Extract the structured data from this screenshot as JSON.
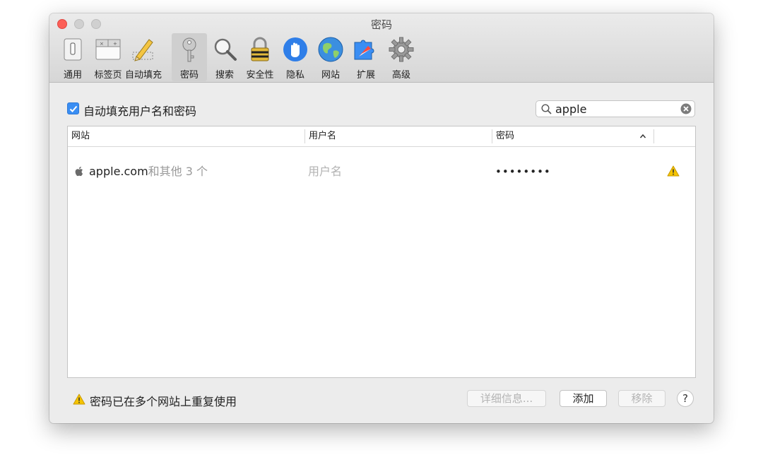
{
  "window": {
    "title": "密码"
  },
  "toolbar": {
    "items": [
      {
        "label": "通用",
        "icon": "general-switch-icon"
      },
      {
        "label": "标签页",
        "icon": "tabs-icon"
      },
      {
        "label": "自动填充",
        "icon": "pencil-icon"
      },
      {
        "label": "密码",
        "icon": "key-icon",
        "active": true
      },
      {
        "label": "搜索",
        "icon": "magnifier-icon"
      },
      {
        "label": "安全性",
        "icon": "lock-icon"
      },
      {
        "label": "隐私",
        "icon": "hand-icon"
      },
      {
        "label": "网站",
        "icon": "globe-icon"
      },
      {
        "label": "扩展",
        "icon": "puzzle-compass-icon"
      },
      {
        "label": "高级",
        "icon": "gear-icon"
      }
    ]
  },
  "autofill": {
    "label": "自动填充用户名和密码",
    "checked": true
  },
  "search": {
    "value": "apple",
    "placeholder": ""
  },
  "table": {
    "columns": [
      "网站",
      "用户名",
      "密码"
    ],
    "sorted_column": "密码",
    "sort_direction": "ascending",
    "rows": [
      {
        "site": "apple.com",
        "site_extra": "和其他 3 个",
        "username": "用户名",
        "password": "••••••••",
        "warning": true
      }
    ]
  },
  "footer": {
    "message": "密码已在多个网站上重复使用",
    "details_label": "详细信息...",
    "add_label": "添加",
    "remove_label": "移除",
    "help_label": "?"
  },
  "colors": {
    "accent": "#3a8ef3",
    "close": "#fc5f57",
    "warning": "#f5c400"
  }
}
